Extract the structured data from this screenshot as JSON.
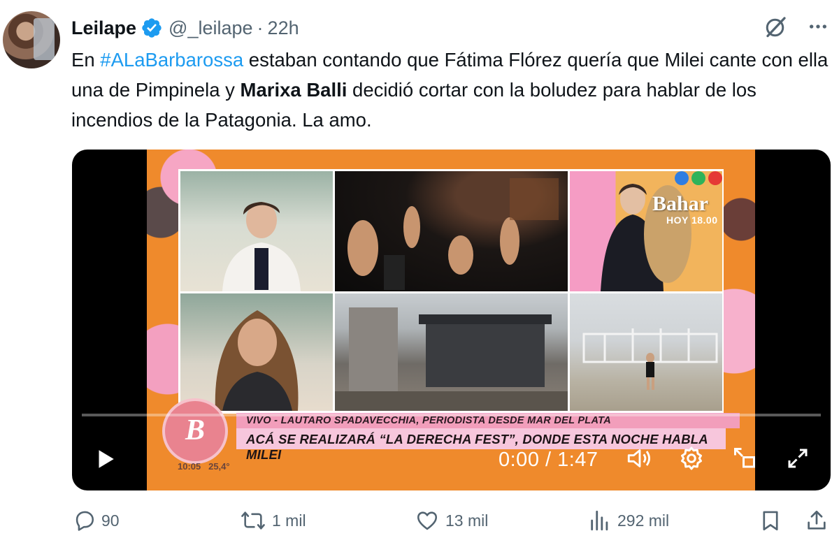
{
  "author": {
    "display_name": "Leilape",
    "handle": "@_leilape",
    "separator": "·",
    "time": "22h"
  },
  "tweet": {
    "parts": [
      "En ",
      "#ALaBarbarossa",
      " estaban contando  que Fátima Flórez quería que Milei cante con ella una de Pimpinela y ",
      "Marixa Balli",
      " decidió cortar con la boludez para hablar de los incendios de la Patagonia. La amo."
    ]
  },
  "video": {
    "overlay_brand": "Bahar",
    "overlay_brand_sub": "HOY 18.00",
    "lower_third_top": "VIVO - LAUTARO SPADAVECCHIA, PERIODISTA DESDE MAR DEL PLATA",
    "lower_third_main": "ACÁ SE REALIZARÁ “LA DERECHA FEST”, DONDE ESTA NOCHE HABLA MILEI",
    "show_logo_letter": "B",
    "status_time": "10:05",
    "status_temp": "25,4°",
    "time_display": "0:00 / 1:47",
    "progress": 0
  },
  "actions": {
    "replies": "90",
    "reposts": "1 mil",
    "likes": "13 mil",
    "views": "292 mil"
  },
  "icons": [
    "verified-badge-icon",
    "grok-icon",
    "more-icon",
    "play-icon",
    "volume-icon",
    "settings-icon",
    "pip-icon",
    "fullscreen-icon",
    "reply-icon",
    "repost-icon",
    "like-icon",
    "views-icon",
    "bookmark-icon",
    "share-icon"
  ],
  "colors": {
    "accent": "#1d9bf0",
    "muted": "#536471",
    "text": "#0f1419"
  }
}
